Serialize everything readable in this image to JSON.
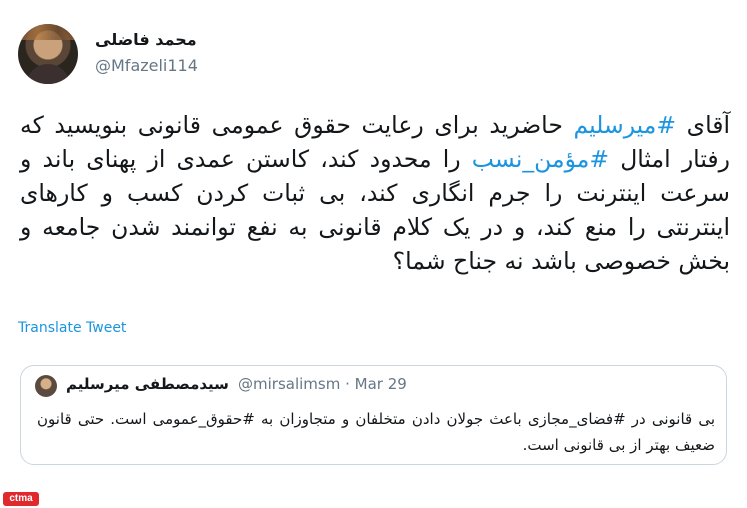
{
  "author": {
    "name": "محمد فاضلی",
    "handle": "@Mfazeli114"
  },
  "tweet": {
    "segments": [
      {
        "text": "آقای ",
        "hashtag": false
      },
      {
        "text": "#میرسلیم",
        "hashtag": true
      },
      {
        "text": " حاضرید برای رعایت حقوق عمومی قانونی بنویسید که رفتار امثال ",
        "hashtag": false
      },
      {
        "text": "#مؤمن_نسب",
        "hashtag": true
      },
      {
        "text": " را محدود کند، کاستن عمدی از پهنای باند و سرعت اینترنت را جرم انگاری کند، بی ثبات کردن کسب و کارهای اینترنتی را منع کند، و در یک کلام قانونی به نفع توانمند شدن جامعه و بخش خصوصی باشد نه جناح شما؟",
        "hashtag": false
      }
    ]
  },
  "translate_label": "Translate Tweet",
  "quoted_tweet": {
    "name": "سیدمصطفی میرسلیم",
    "meta": "@mirsalimsm · Mar 29",
    "text": "بی قانونی در #فضای_مجازی باعث جولان دادن متخلفان و متجاوزان به #حقوق_عمومی است. حتی قانون ضعیف بهتر از بی قانونی است."
  },
  "watermark": "ctma",
  "colors": {
    "link": "#1b95e0",
    "muted": "#657786",
    "border": "#ccd6dd",
    "logo": "#e0282f"
  }
}
